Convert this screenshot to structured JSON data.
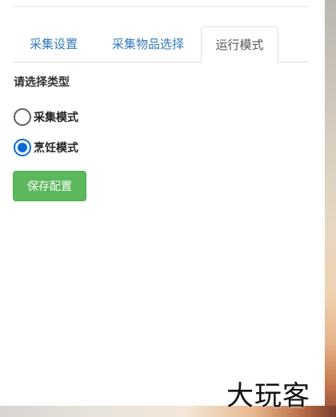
{
  "tabs": [
    {
      "label": "采集设置",
      "active": false
    },
    {
      "label": "采集物品选择",
      "active": false
    },
    {
      "label": "运行模式",
      "active": true
    }
  ],
  "form": {
    "section_label": "请选择类型",
    "options": [
      {
        "label": "采集模式",
        "checked": false
      },
      {
        "label": "烹饪模式",
        "checked": true
      }
    ],
    "save_label": "保存配置"
  },
  "watermark": "大玩客",
  "colors": {
    "tab_link": "#337ab7",
    "tab_active_text": "#555555",
    "radio_checked": "#0b6bd6",
    "save_button": "#5cb85c"
  }
}
